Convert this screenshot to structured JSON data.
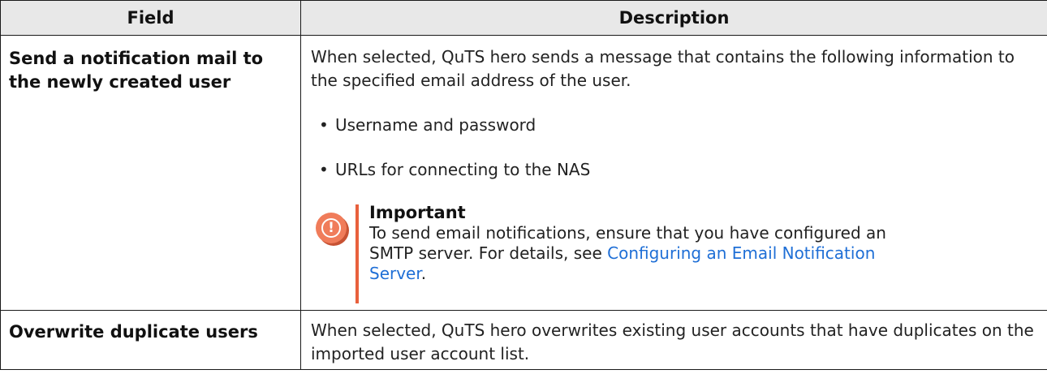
{
  "table": {
    "headers": {
      "field": "Field",
      "description": "Description"
    },
    "rows": [
      {
        "field": "Send a notification mail to the newly created user",
        "description": "When selected, QuTS hero sends a message that contains the following information to the specified email address of the user.",
        "bullets": [
          "Username and password",
          "URLs for connecting to the NAS"
        ],
        "note": {
          "icon": "important-icon",
          "title": "Important",
          "text": "To send email notifications, ensure that you have configured an SMTP server. For details, see ",
          "link_text": "Configuring an Email Notification Server",
          "trailing": "."
        }
      },
      {
        "field": "Overwrite duplicate users",
        "description": "When selected, QuTS hero overwrites existing user accounts that have duplicates on the imported user account list."
      }
    ]
  },
  "colors": {
    "header_bg": "#e8e8e8",
    "important_accent": "#e8603c",
    "link": "#1f6fd6"
  }
}
